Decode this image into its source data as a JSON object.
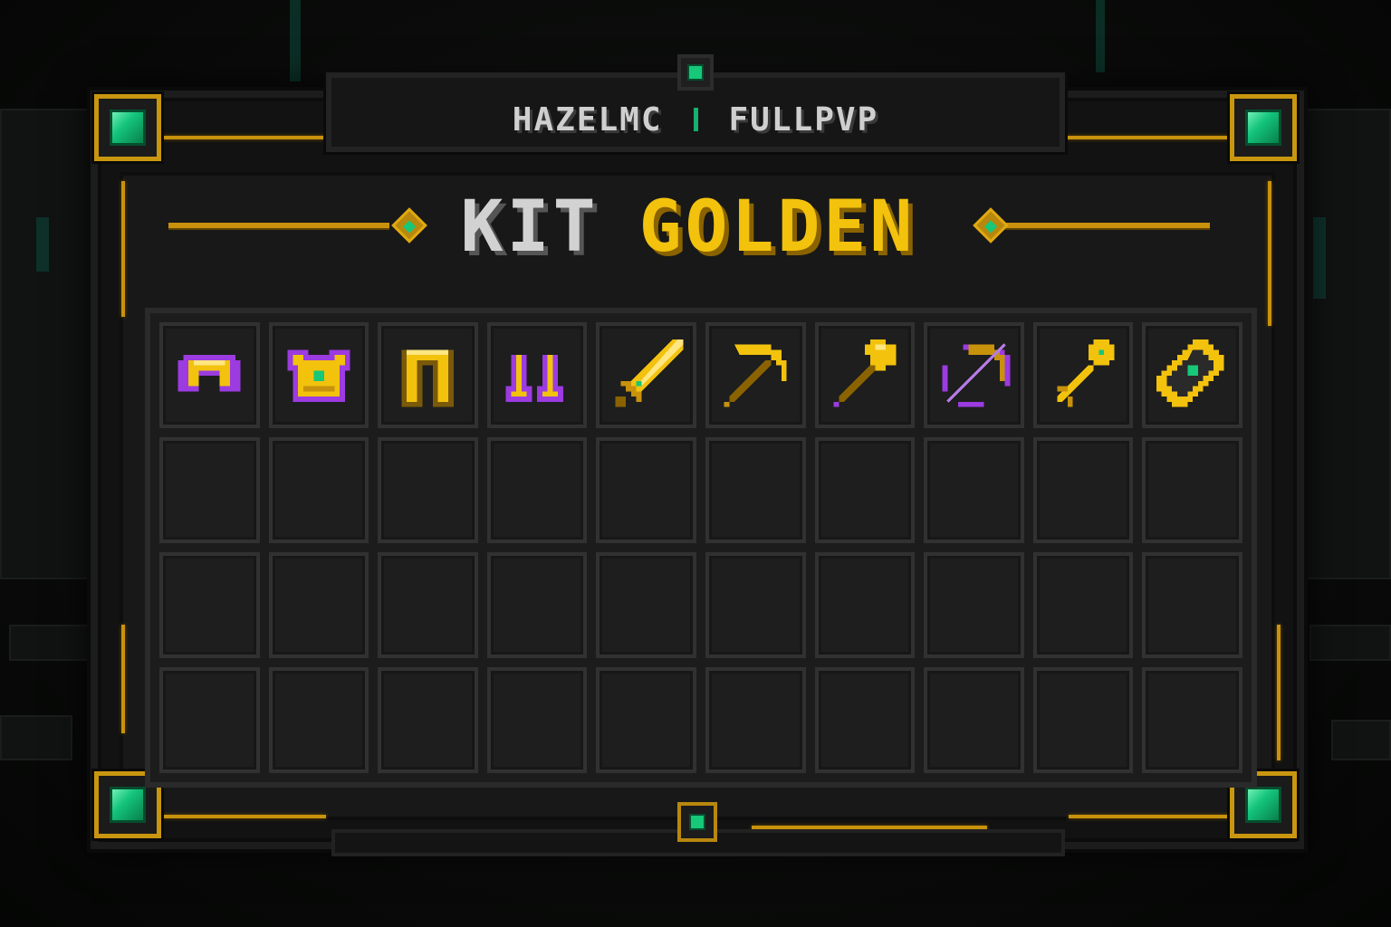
{
  "server_header": {
    "left": "HAZELMC",
    "right": "FULLPVP"
  },
  "kit_title": {
    "prefix": "KIT",
    "name": "GOLDEN"
  },
  "inventory": {
    "rows": 4,
    "columns": 10,
    "filled_row": [
      {
        "item": "golden-helmet-icon"
      },
      {
        "item": "golden-chestplate-icon"
      },
      {
        "item": "golden-leggings-icon"
      },
      {
        "item": "golden-boots-icon"
      },
      {
        "item": "golden-sword-icon"
      },
      {
        "item": "golden-pickaxe-icon"
      },
      {
        "item": "golden-axe-icon"
      },
      {
        "item": "bow-icon"
      },
      {
        "item": "golden-key-icon"
      },
      {
        "item": "golden-ticket-icon"
      }
    ]
  },
  "colors": {
    "gold": "#f2c20d",
    "emerald": "#16c878",
    "enchant_purple": "#9b3be0",
    "panel": "#181818"
  }
}
